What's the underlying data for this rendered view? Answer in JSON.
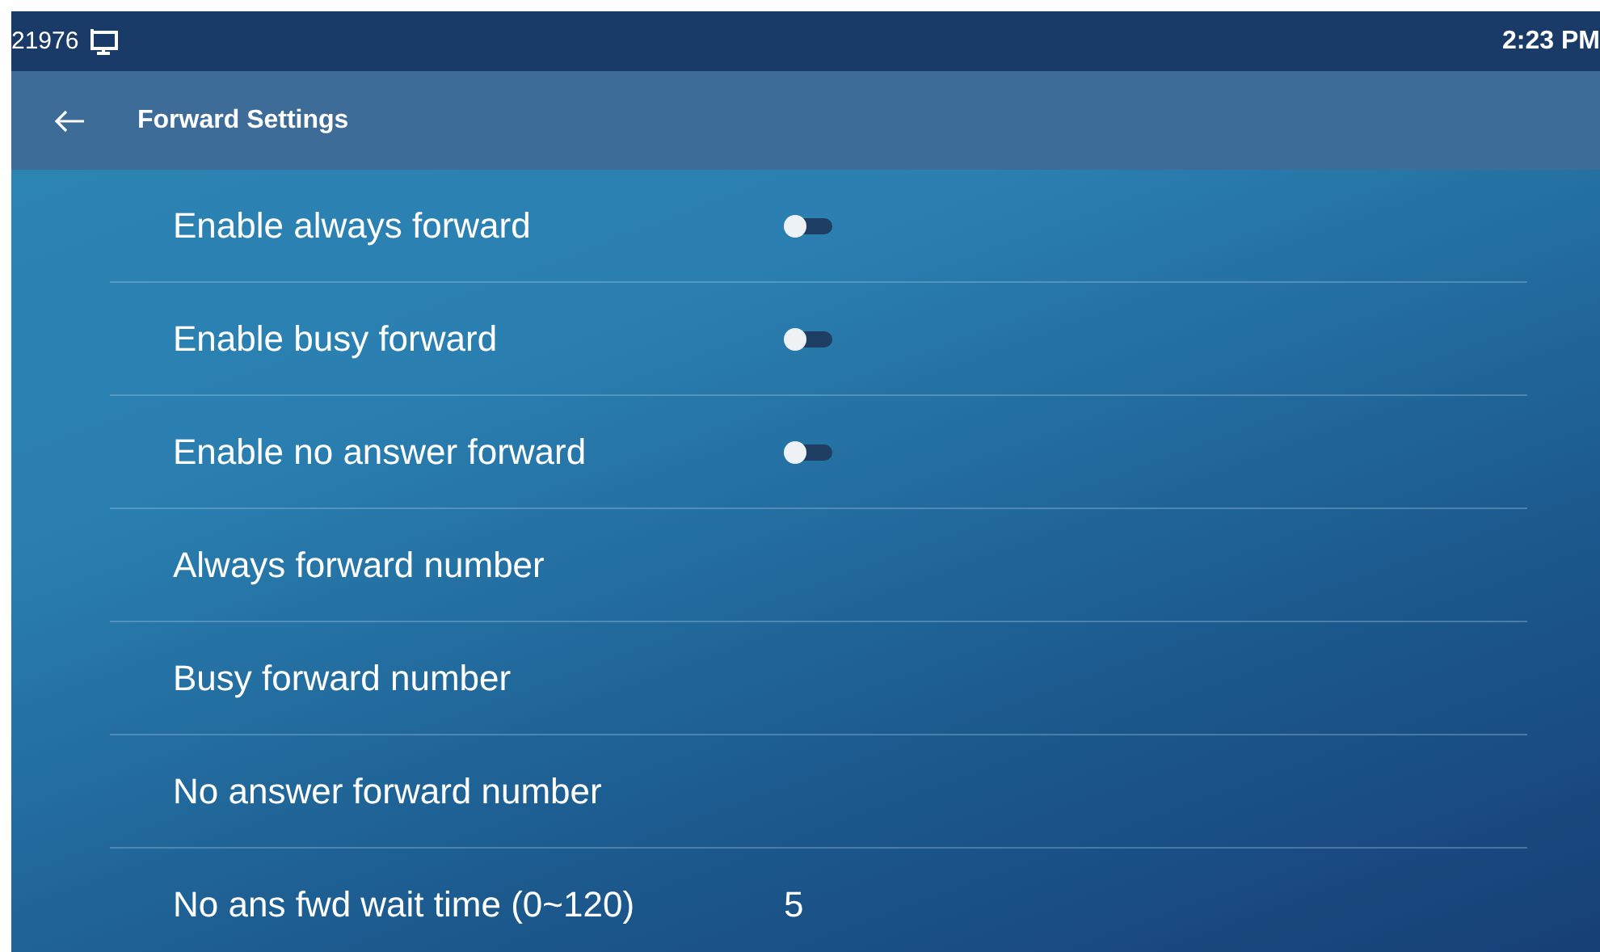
{
  "status_bar": {
    "extension": "21976",
    "time": "2:23 PM"
  },
  "header": {
    "title": "Forward Settings"
  },
  "settings": [
    {
      "kind": "toggle",
      "label": "Enable always forward",
      "on": false
    },
    {
      "kind": "toggle",
      "label": "Enable busy forward",
      "on": false
    },
    {
      "kind": "toggle",
      "label": "Enable no answer forward",
      "on": false
    },
    {
      "kind": "entry",
      "label": "Always forward number"
    },
    {
      "kind": "entry",
      "label": "Busy forward number"
    },
    {
      "kind": "entry",
      "label": "No answer forward number"
    },
    {
      "kind": "entry",
      "label": "No ans fwd wait time (0~120)",
      "value": "5"
    }
  ]
}
